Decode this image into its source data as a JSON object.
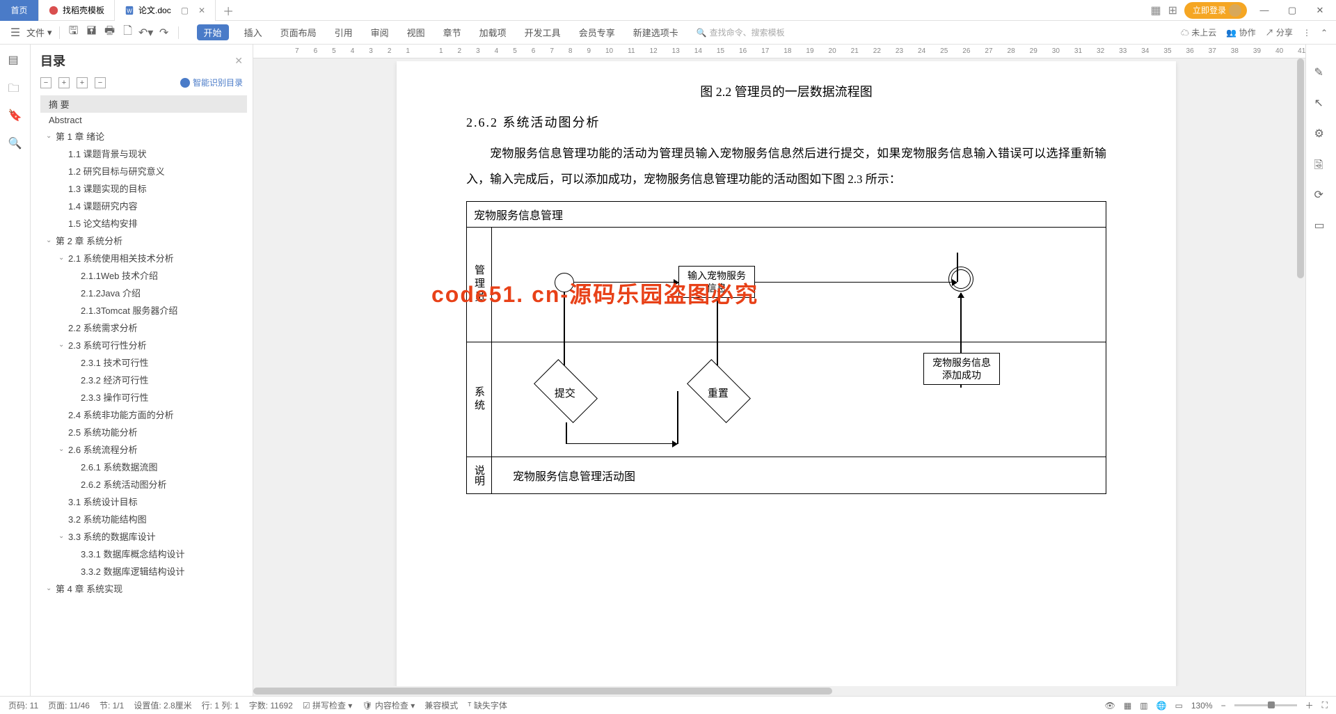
{
  "tabs": {
    "home": "首页",
    "t1": "找稻壳模板",
    "t2": "论文.doc"
  },
  "title_right": {
    "login": "立即登录"
  },
  "toolbar": {
    "file": "文件",
    "ribbon": [
      "开始",
      "插入",
      "页面布局",
      "引用",
      "审阅",
      "视图",
      "章节",
      "加载项",
      "开发工具",
      "会员专享",
      "新建选项卡"
    ],
    "search_placeholder": "查找命令、搜索模板",
    "cloud": "未上云",
    "collab": "协作",
    "share": "分享"
  },
  "toc": {
    "title": "目录",
    "smart": "智能识别目录",
    "items": [
      {
        "lvl": 0,
        "t": "摘 要",
        "sel": true
      },
      {
        "lvl": 0,
        "t": "Abstract"
      },
      {
        "lvl": 1,
        "t": "第 1 章  绪论",
        "chev": "v"
      },
      {
        "lvl": 2,
        "t": "1.1 课题背景与现状"
      },
      {
        "lvl": 2,
        "t": "1.2 研究目标与研究意义"
      },
      {
        "lvl": 2,
        "t": "1.3 课题实现的目标"
      },
      {
        "lvl": 2,
        "t": "1.4 课题研究内容"
      },
      {
        "lvl": 2,
        "t": "1.5 论文结构安排"
      },
      {
        "lvl": 1,
        "t": "第 2 章  系统分析",
        "chev": "v"
      },
      {
        "lvl": 2,
        "t": "2.1 系统使用相关技术分析",
        "chev": "v"
      },
      {
        "lvl": 3,
        "t": "2.1.1Web 技术介绍"
      },
      {
        "lvl": 3,
        "t": "2.1.2Java 介绍"
      },
      {
        "lvl": 3,
        "t": "2.1.3Tomcat 服务器介绍"
      },
      {
        "lvl": 2,
        "t": "2.2 系统需求分析"
      },
      {
        "lvl": 2,
        "t": "2.3 系统可行性分析",
        "chev": "v"
      },
      {
        "lvl": 3,
        "t": "2.3.1 技术可行性"
      },
      {
        "lvl": 3,
        "t": "2.3.2 经济可行性"
      },
      {
        "lvl": 3,
        "t": "2.3.3 操作可行性"
      },
      {
        "lvl": 2,
        "t": "2.4 系统非功能方面的分析"
      },
      {
        "lvl": 2,
        "t": "2.5 系统功能分析"
      },
      {
        "lvl": 2,
        "t": "2.6 系统流程分析",
        "chev": "v"
      },
      {
        "lvl": 3,
        "t": "2.6.1 系统数据流图"
      },
      {
        "lvl": 3,
        "t": "2.6.2 系统活动图分析"
      },
      {
        "lvl": 2,
        "t": "3.1 系统设计目标"
      },
      {
        "lvl": 2,
        "t": "3.2 系统功能结构图"
      },
      {
        "lvl": 2,
        "t": "3.3 系统的数据库设计",
        "chev": "v"
      },
      {
        "lvl": 3,
        "t": "3.3.1 数据库概念结构设计"
      },
      {
        "lvl": 3,
        "t": "3.3.2 数据库逻辑结构设计"
      },
      {
        "lvl": 1,
        "t": "第 4 章  系统实现",
        "chev": "v"
      }
    ]
  },
  "ruler": [
    "7",
    "6",
    "5",
    "4",
    "3",
    "2",
    "1",
    "",
    "1",
    "2",
    "3",
    "4",
    "5",
    "6",
    "7",
    "8",
    "9",
    "10",
    "11",
    "12",
    "13",
    "14",
    "15",
    "16",
    "17",
    "18",
    "19",
    "20",
    "21",
    "22",
    "23",
    "24",
    "25",
    "26",
    "27",
    "28",
    "29",
    "30",
    "31",
    "32",
    "33",
    "34",
    "35",
    "36",
    "37",
    "38",
    "39",
    "40",
    "41"
  ],
  "doc": {
    "caption": "图 2.2 管理员的一层数据流程图",
    "h3": "2.6.2 系统活动图分析",
    "para": "宠物服务信息管理功能的活动为管理员输入宠物服务信息然后进行提交，如果宠物服务信息输入错误可以选择重新输入，输入完成后，可以添加成功，宠物服务信息管理功能的活动图如下图 2.3 所示：",
    "watermark": "code51. cn-源码乐园盗图必究",
    "diagram": {
      "title": "宠物服务信息管理",
      "row1_label": "管理员",
      "row2_label": "系统",
      "box_input": "输入宠物服务信息",
      "diamond_submit": "提交",
      "diamond_reset": "重置",
      "box_success": "宠物服务信息添加成功",
      "footer_label": "说明",
      "footer_text": "宠物服务信息管理活动图"
    }
  },
  "status": {
    "page_num": "页码: 11",
    "page": "页面: 11/46",
    "section": "节: 1/1",
    "setting": "设置值: 2.8厘米",
    "row": "行: 1  列: 1",
    "words": "字数: 11692",
    "spell": "拼写检查",
    "content": "内容检查",
    "compat": "兼容模式",
    "font": "缺失字体",
    "zoom": "130%"
  }
}
